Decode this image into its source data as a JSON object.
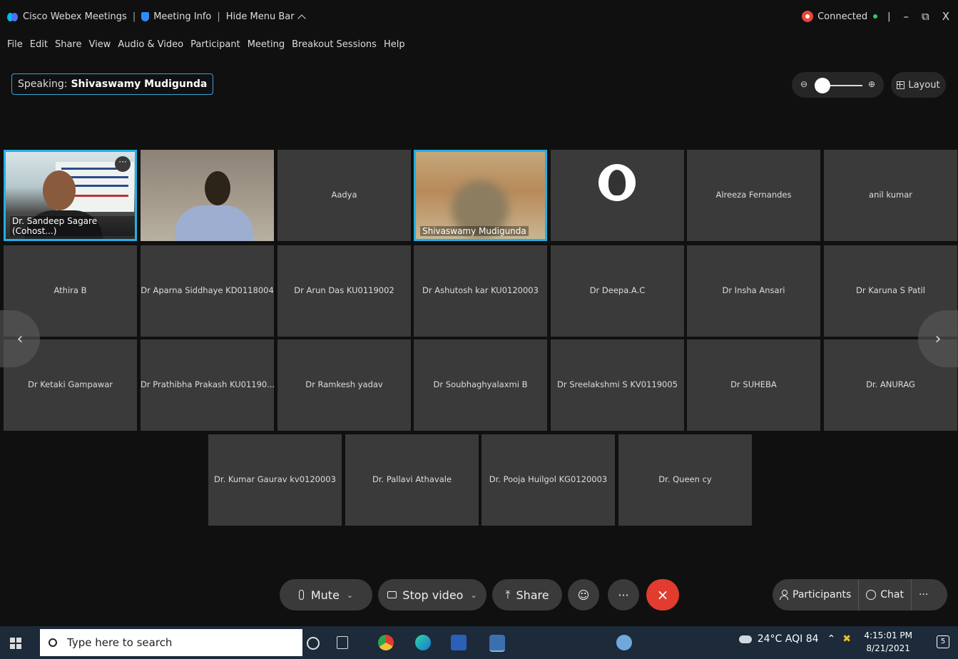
{
  "titlebar": {
    "app_name": "Cisco Webex Meetings",
    "meeting_info": "Meeting Info",
    "hide_menu": "Hide Menu Bar",
    "status": "Connected",
    "win_min": "–",
    "win_max": "⧉",
    "win_close": "X"
  },
  "menu": [
    "File",
    "Edit",
    "Share",
    "View",
    "Audio & Video",
    "Participant",
    "Meeting",
    "Breakout Sessions",
    "Help"
  ],
  "speaking": {
    "label": "Speaking:",
    "name": "Shivaswamy Mudigunda"
  },
  "zoom": {
    "out": "⊖",
    "in": "⊕"
  },
  "layout_label": "Layout",
  "tiles": [
    {
      "name": "Dr. Sandeep Sagare (Cohost...)",
      "video": true
    },
    {
      "name": "",
      "video": true
    },
    {
      "name": "Aadya",
      "video": false
    },
    {
      "name": "Shivaswamy Mudigunda",
      "video": true
    },
    {
      "name": "",
      "video": false
    },
    {
      "name": "Alreeza Fernandes",
      "video": false
    },
    {
      "name": "anil kumar",
      "video": false
    },
    {
      "name": "Athira B",
      "video": false
    },
    {
      "name": "Dr Aparna Siddhaye KD0118004",
      "video": false
    },
    {
      "name": "Dr Arun Das KU0119002",
      "video": false
    },
    {
      "name": "Dr Ashutosh kar KU0120003",
      "video": false
    },
    {
      "name": "Dr Deepa.A.C",
      "video": false
    },
    {
      "name": "Dr Insha Ansari",
      "video": false
    },
    {
      "name": "Dr Karuna S Patil",
      "video": false
    },
    {
      "name": "Dr Ketaki Gampawar",
      "video": false
    },
    {
      "name": "Dr Prathibha Prakash KU01190...",
      "video": false
    },
    {
      "name": "Dr Ramkesh yadav",
      "video": false
    },
    {
      "name": "Dr Soubhaghyalaxmi B",
      "video": false
    },
    {
      "name": "Dr Sreelakshmi S KV0119005",
      "video": false
    },
    {
      "name": "Dr SUHEBA",
      "video": false
    },
    {
      "name": "Dr. ANURAG",
      "video": false
    },
    {
      "name": "Dr. Kumar Gaurav kv0120003",
      "video": false
    },
    {
      "name": "Dr. Pallavi Athavale",
      "video": false
    },
    {
      "name": "Dr. Pooja Huilgol KG0120003",
      "video": false
    },
    {
      "name": "Dr. Queen cy",
      "video": false
    }
  ],
  "controls": {
    "mute": "Mute",
    "stop_video": "Stop video",
    "share": "Share",
    "more": "···",
    "end": "×",
    "participants": "Participants",
    "chat": "Chat"
  },
  "nav": {
    "prev": "‹",
    "next": "›"
  },
  "taskbar": {
    "search_placeholder": "Type here to search",
    "weather": "24°C AQI 84",
    "time": "4:15:01 PM",
    "date": "8/21/2021",
    "notifications": "5"
  },
  "colors": {
    "active_border": "#22b0e6",
    "end_call": "#e23c2f",
    "tile_bg": "#3a3a3a"
  }
}
